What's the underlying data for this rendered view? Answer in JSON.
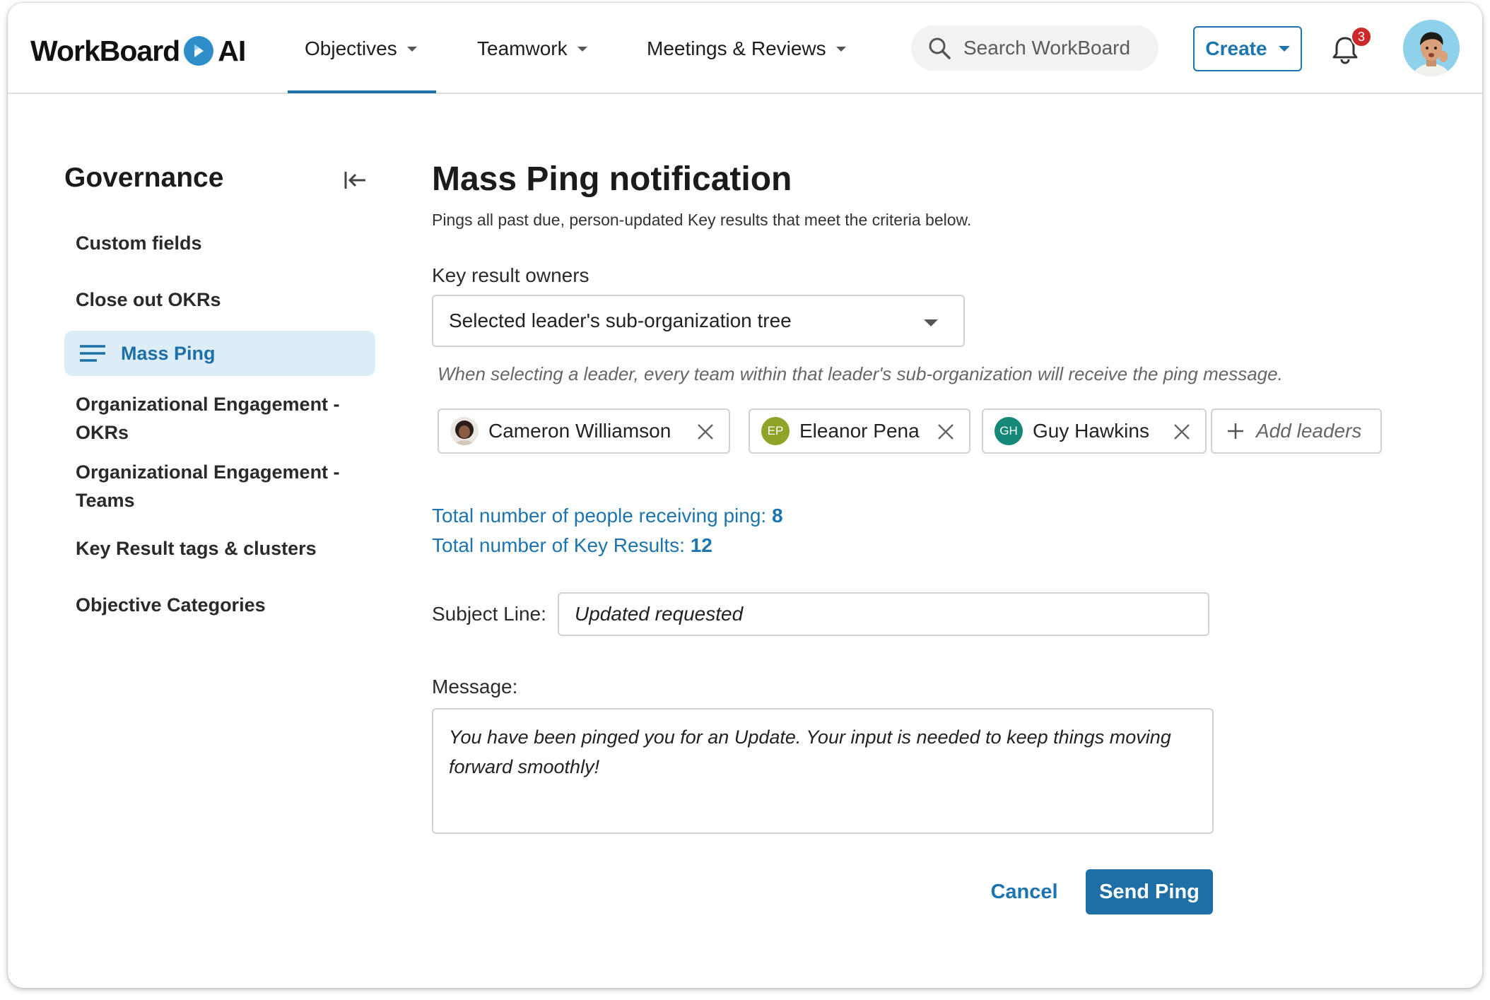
{
  "header": {
    "logo_text_left": "WorkBoard",
    "logo_text_right": "AI",
    "nav": [
      {
        "label": "Objectives"
      },
      {
        "label": "Teamwork"
      },
      {
        "label": "Meetings & Reviews"
      }
    ],
    "search_placeholder": "Search WorkBoard",
    "create_label": "Create",
    "notification_count": "3"
  },
  "sidebar": {
    "title": "Governance",
    "items": [
      {
        "label": "Custom fields"
      },
      {
        "label": "Close out OKRs"
      },
      {
        "label": "Mass Ping",
        "active": true
      },
      {
        "label": "Organizational Engagement - OKRs"
      },
      {
        "label": "Organizational Engagement - Teams"
      },
      {
        "label": "Key Result tags & clusters"
      },
      {
        "label": "Objective Categories"
      }
    ]
  },
  "main": {
    "title": "Mass Ping notification",
    "description": "Pings all past due, person-updated Key results that meet the criteria below.",
    "owners_label": "Key result owners",
    "owners_select_value": "Selected leader's sub-organization tree",
    "hint": "When selecting a leader, every team within that leader's sub-organization will receive the ping message.",
    "leaders": [
      {
        "name": "Cameron Williamson",
        "initials": "",
        "color": "#6b4a3a"
      },
      {
        "name": "Eleanor Pena",
        "initials": "EP",
        "color": "#8fa329"
      },
      {
        "name": "Guy Hawkins",
        "initials": "GH",
        "color": "#14897a"
      }
    ],
    "add_leaders_label": "Add leaders",
    "stats": {
      "people_label": "Total number of people receiving ping:",
      "people_value": "8",
      "kr_label": "Total number of Key Results:",
      "kr_value": "12"
    },
    "subject_label": "Subject Line:",
    "subject_value": "Updated requested",
    "message_label": "Message:",
    "message_value": "You have been pinged you for an Update. Your input is needed to keep things moving forward smoothly!",
    "cancel_label": "Cancel",
    "send_label": "Send Ping"
  },
  "colors": {
    "accent": "#1d74ae",
    "active_bg": "#dcedf7",
    "badge": "#cc2a2a"
  }
}
